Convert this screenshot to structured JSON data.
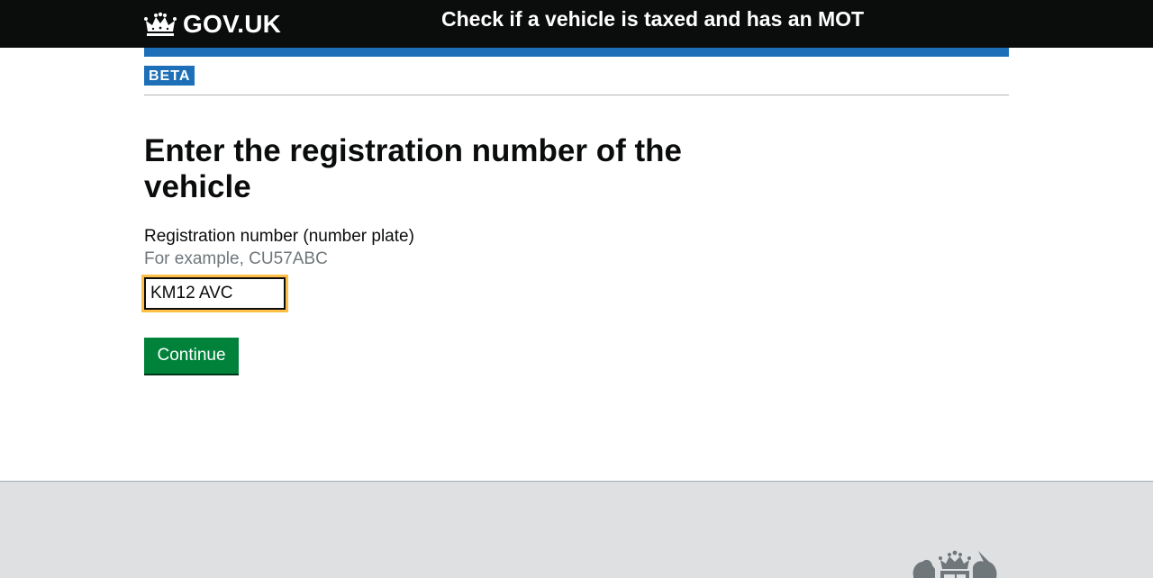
{
  "header": {
    "logo_text": "GOV.UK",
    "service_name": "Check if a vehicle is taxed and has an MOT"
  },
  "phase": {
    "tag": "BETA"
  },
  "main": {
    "heading": "Enter the registration number of the vehicle",
    "field_label": "Registration number (number plate)",
    "field_hint": "For example, CU57ABC",
    "field_value": "KM12 AVC",
    "continue_label": "Continue"
  },
  "colors": {
    "header_bg": "#0b0c0c",
    "brand_blue": "#1d70b8",
    "focus_yellow": "#ffbf47",
    "button_green": "#00823b",
    "footer_bg": "#dee0e2"
  }
}
